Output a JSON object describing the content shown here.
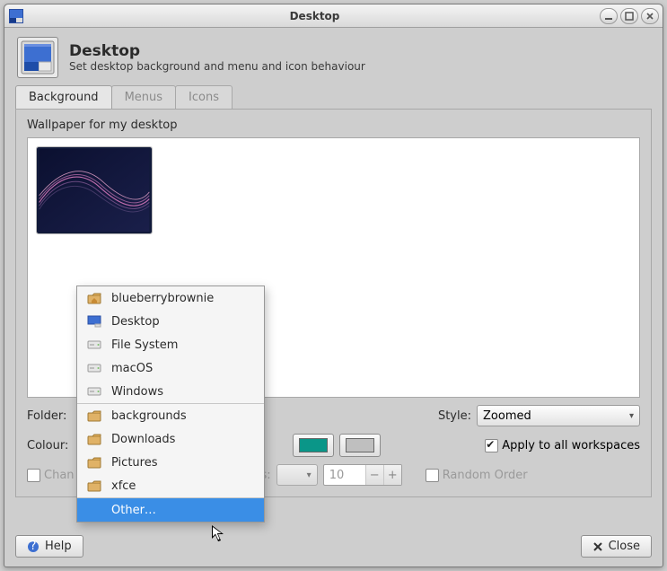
{
  "window": {
    "title": "Desktop"
  },
  "header": {
    "title": "Desktop",
    "subtitle": "Set desktop background and menu and icon behaviour"
  },
  "tabs": {
    "background": "Background",
    "menus": "Menus",
    "icons": "Icons"
  },
  "section": {
    "wallpaper_caption": "Wallpaper for my desktop"
  },
  "labels": {
    "folder": "Folder:",
    "style": "Style:",
    "colour": "Colour:",
    "apply_all": "Apply to all workspaces",
    "change_bg_prefix": "Chan",
    "change_bg_mid_suffix": "s:",
    "random_order": "Random Order",
    "spin_value": "10"
  },
  "style": {
    "selected": "Zoomed"
  },
  "colors": {
    "teal": "#0a9688",
    "grey": "#bfbfbf"
  },
  "folder_menu": {
    "items": [
      {
        "label": "blueberrybrownie",
        "icon": "home"
      },
      {
        "label": "Desktop",
        "icon": "desktop"
      },
      {
        "label": "File System",
        "icon": "drive"
      },
      {
        "label": "macOS",
        "icon": "drive"
      },
      {
        "label": "Windows",
        "icon": "drive"
      },
      {
        "label": "backgrounds",
        "icon": "folder"
      },
      {
        "label": "Downloads",
        "icon": "folder"
      },
      {
        "label": "Pictures",
        "icon": "folder"
      },
      {
        "label": "xfce",
        "icon": "folder"
      },
      {
        "label": "Other…",
        "icon": "none",
        "selected": true
      }
    ]
  },
  "buttons": {
    "help": "Help",
    "close": "Close"
  }
}
